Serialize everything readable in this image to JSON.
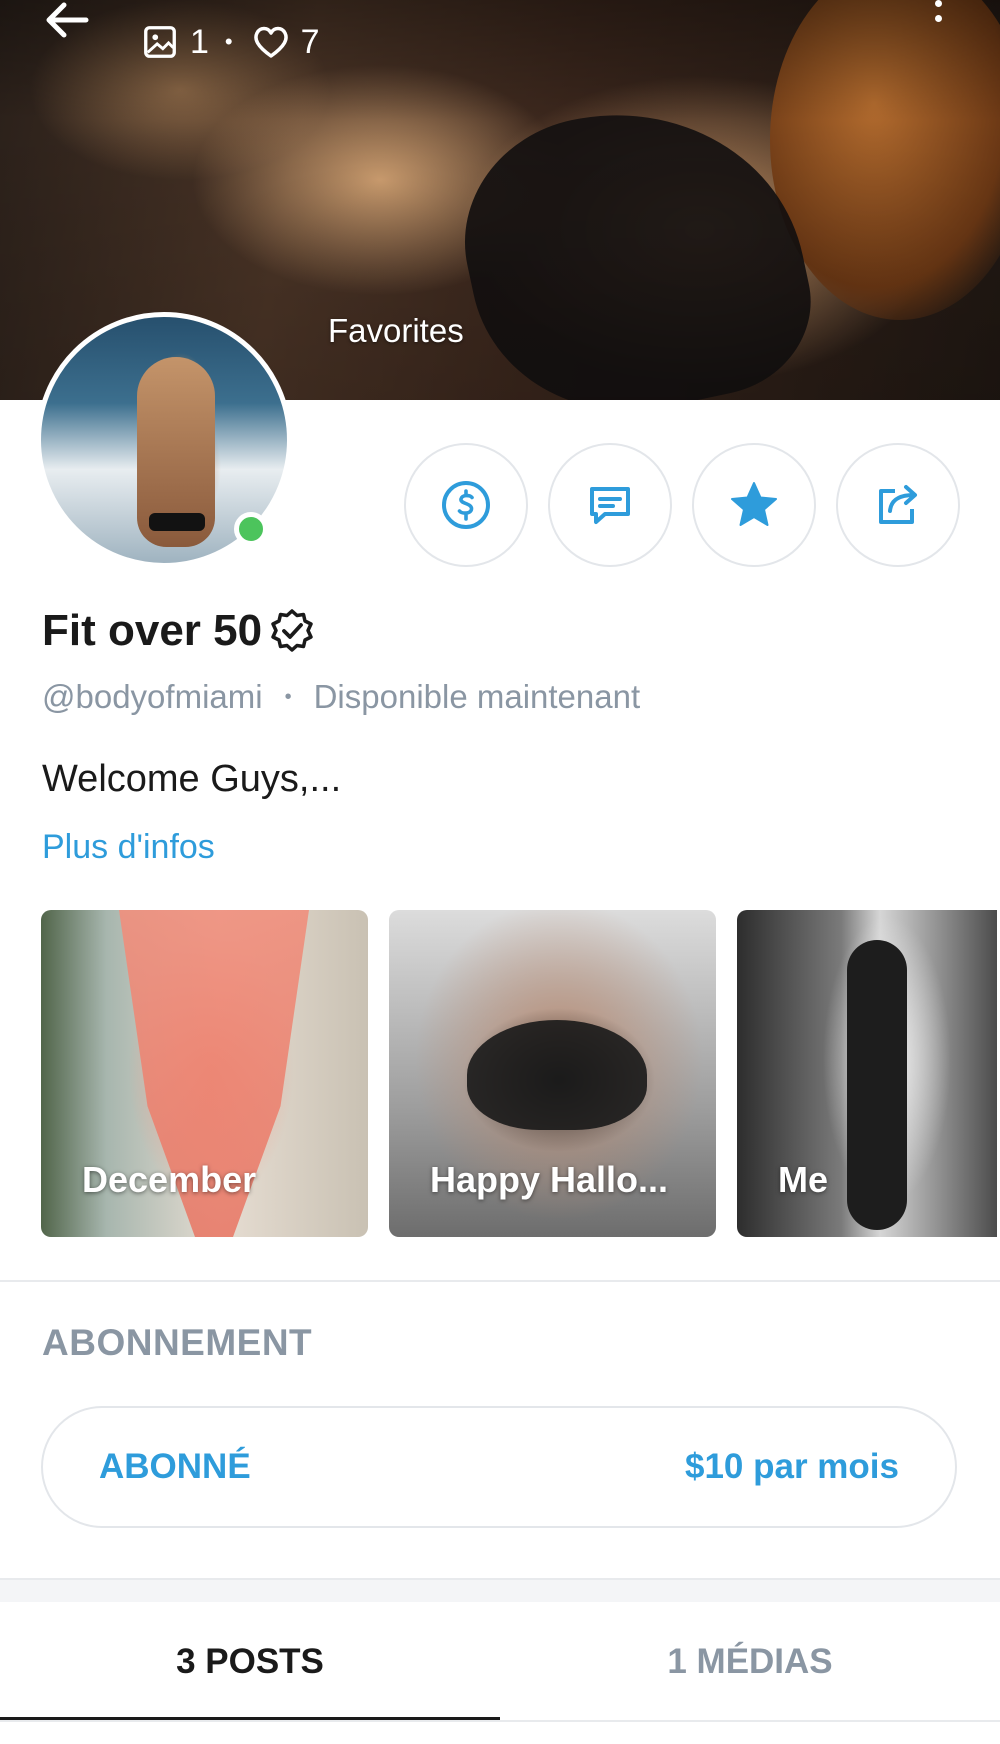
{
  "header": {
    "stats": {
      "media_count": "1",
      "likes_count": "7"
    },
    "cover_caption": "Favorites"
  },
  "profile": {
    "name": "Fit over 50",
    "username": "@bodyofmiami",
    "separator": "•",
    "status": "Disponible maintenant",
    "online": true,
    "bio": "Welcome Guys,...",
    "more_info_link": "Plus d'infos"
  },
  "actions": [
    {
      "icon": "dollar-icon"
    },
    {
      "icon": "message-icon"
    },
    {
      "icon": "star-icon"
    },
    {
      "icon": "share-icon"
    }
  ],
  "highlights": [
    {
      "label": "December"
    },
    {
      "label": "Happy Hallo..."
    },
    {
      "label": "Me"
    }
  ],
  "subscription": {
    "title": "ABONNEMENT",
    "status_label": "ABONNÉ",
    "price_label": "$10 par mois"
  },
  "tabs": [
    {
      "label": "3 POSTS",
      "active": true
    },
    {
      "label": "1 MÉDIAS",
      "active": false
    }
  ],
  "colors": {
    "accent": "#2e9cdb",
    "muted": "#8a96a3",
    "online": "#4cc45c",
    "text": "#1a1a1a"
  }
}
